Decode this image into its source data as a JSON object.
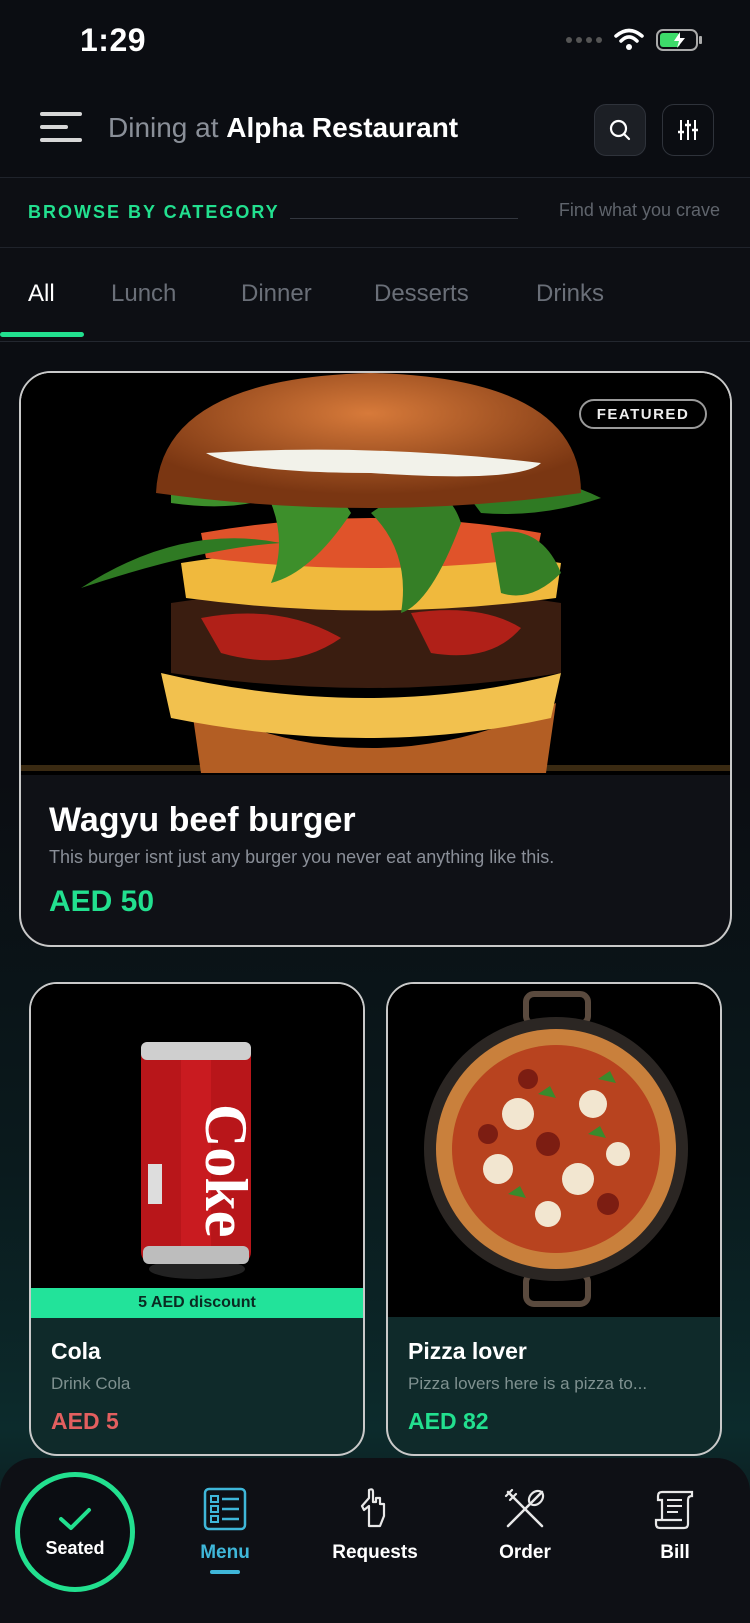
{
  "status_bar": {
    "time": "1:29"
  },
  "header": {
    "dining_prefix": "Dining at",
    "restaurant_name": "Alpha Restaurant",
    "search_icon": "search-icon",
    "filter_icon": "sliders-icon"
  },
  "browse": {
    "label": "BROWSE BY CATEGORY",
    "hint": "Find what you crave"
  },
  "tabs": [
    {
      "label": "All",
      "active": true
    },
    {
      "label": "Lunch",
      "active": false
    },
    {
      "label": "Dinner",
      "active": false
    },
    {
      "label": "Desserts",
      "active": false
    },
    {
      "label": "Drinks",
      "active": false
    }
  ],
  "featured": {
    "badge": "FEATURED",
    "title": "Wagyu beef burger",
    "description": "This burger isnt just any burger you never eat anything like this.",
    "price": "AED 50"
  },
  "products": [
    {
      "name": "Cola",
      "description": "Drink Cola",
      "price": "AED 5",
      "discount": "5 AED discount",
      "price_color": "#e35f5f",
      "can_text": "Coke"
    },
    {
      "name": "Pizza lover",
      "description": "Pizza lovers here is a pizza to...",
      "price": "AED 82",
      "price_color": "#22e08f"
    }
  ],
  "bottom_nav": {
    "seated": "Seated",
    "items": [
      {
        "label": "Menu",
        "icon": "menu-list-icon",
        "active": true
      },
      {
        "label": "Requests",
        "icon": "hand-icon",
        "active": false
      },
      {
        "label": "Order",
        "icon": "utensils-icon",
        "active": false
      },
      {
        "label": "Bill",
        "icon": "receipt-icon",
        "active": false
      }
    ]
  },
  "colors": {
    "accent": "#22e08f",
    "active_nav": "#3fb7d9",
    "discount": "#22e39a",
    "background": "#0b0d12"
  }
}
